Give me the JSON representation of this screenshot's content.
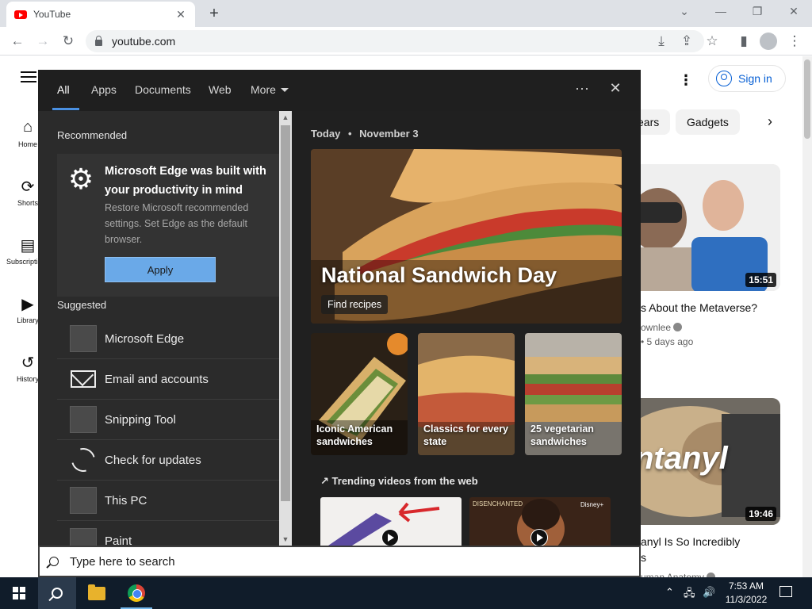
{
  "browser": {
    "tab_title": "YouTube",
    "tab_close": "✕",
    "new_tab": "+",
    "url": "youtube.com",
    "window_controls": {
      "collapse": "⌄",
      "minimize": "—",
      "restore": "❐",
      "close": "✕"
    },
    "nav": {
      "back": "←",
      "forward": "→",
      "reload": "↻",
      "install": "⤓",
      "share": "⇪",
      "bookmark": "☆",
      "side_panel": "▮",
      "menu": "⋮"
    }
  },
  "youtube": {
    "guide": [
      {
        "icon": "home-icon",
        "glyph": "⌂",
        "label": "Home"
      },
      {
        "icon": "shorts-icon",
        "glyph": "⟳",
        "label": "Shorts"
      },
      {
        "icon": "subscriptions-icon",
        "glyph": "▤",
        "label": "Subscriptions"
      },
      {
        "icon": "library-icon",
        "glyph": "▶",
        "label": "Library"
      },
      {
        "icon": "history-icon",
        "glyph": "↺",
        "label": "History"
      }
    ],
    "more_glyph": "⋮",
    "sign_in": "Sign in",
    "chips": [
      "ears",
      "Gadgets"
    ],
    "chip_next": "›",
    "videos": [
      {
        "duration": "15:51",
        "title": "s About the Metaverse?",
        "channel": "ownlee",
        "age": "5 days ago"
      },
      {
        "duration": "19:46",
        "title": "anyl Is So Incredibly",
        "title_line2": "s",
        "thumb_text": "ntanyl",
        "channel": "uman Anatomy"
      }
    ]
  },
  "search_panel": {
    "tabs": [
      "All",
      "Apps",
      "Documents",
      "Web",
      "More"
    ],
    "header_more": "···",
    "header_close": "✕",
    "recommended_heading": "Recommended",
    "recommended": {
      "icon": "gear-icon",
      "glyph": "⚙",
      "title": "Microsoft Edge was built with your productivity in mind",
      "body": "Restore Microsoft recommended settings. Set Edge as the default browser.",
      "button": "Apply"
    },
    "suggested_heading": "Suggested",
    "suggested": [
      {
        "label": "Microsoft Edge",
        "icon": "edge-icon"
      },
      {
        "label": "Email and accounts",
        "icon": "mail-icon"
      },
      {
        "label": "Snipping Tool",
        "icon": "snipping-tool-icon"
      },
      {
        "label": "Check for updates",
        "icon": "refresh-icon"
      },
      {
        "label": "This PC",
        "icon": "this-pc-icon"
      },
      {
        "label": "Paint",
        "icon": "paint-icon"
      }
    ],
    "scroll_up": "▲",
    "scroll_down": "▼",
    "today_label": "Today",
    "date_separator": "•",
    "date": "November 3",
    "hero_title": "National Sandwich Day",
    "hero_button": "Find recipes",
    "tiles": [
      {
        "label": "Iconic American sandwiches"
      },
      {
        "label": "Classics for every state"
      },
      {
        "label": "25 vegetarian sandwiches"
      }
    ],
    "trending_icon": "↗",
    "trending_heading": "Trending videos from the web",
    "trend_video_text": "DISENCHANTED",
    "disney_badge": "Disney+"
  },
  "search_box": {
    "placeholder": "Type here to search"
  },
  "taskbar": {
    "time": "7:53 AM",
    "date": "11/3/2022",
    "tray_chevron": "⌃",
    "tray_network": "🖧",
    "tray_volume": "🔊"
  },
  "colors": {
    "panel_bg": "#2b2b2b",
    "panel_header": "#1f1f1f",
    "accent": "#4a90e2",
    "apply_button": "#6aa9e8",
    "youtube_red": "#ff0000",
    "youtube_link": "#065fd4",
    "taskbar": "#101c2a"
  }
}
